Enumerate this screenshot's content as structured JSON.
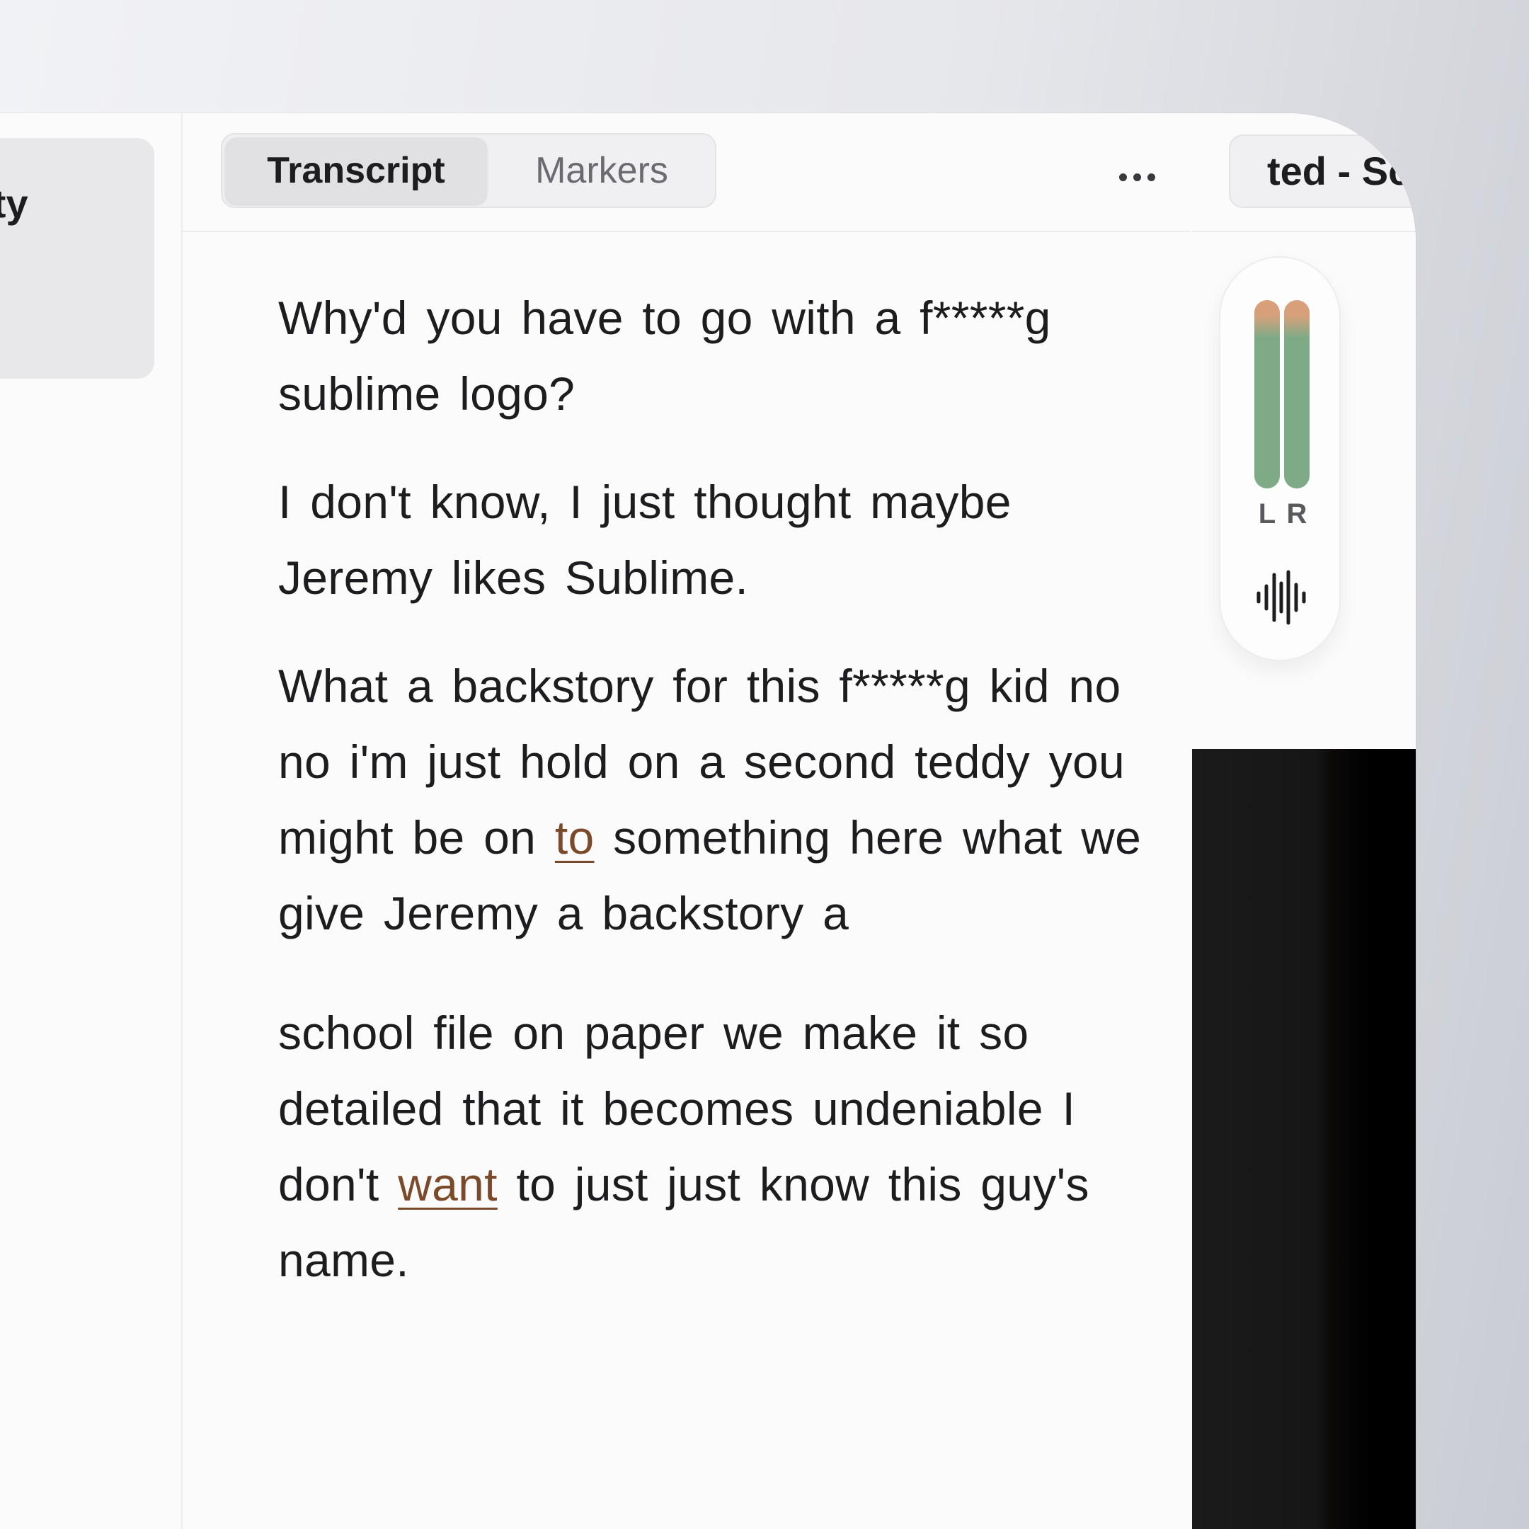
{
  "left_pane": {
    "card_title_fragment": "rty"
  },
  "center": {
    "tabs": [
      {
        "label": "Transcript",
        "active": true
      },
      {
        "label": "Markers",
        "active": false
      }
    ],
    "more_icon": "ellipsis-icon",
    "transcript": {
      "paragraphs": [
        {
          "text": "Why'd you have to go with a f*****g sublime logo?"
        },
        {
          "text": "I don't know, I just thought maybe Jeremy likes Sublime."
        },
        {
          "before": "What a backstory for this f*****g kid no no i'm just hold on a second teddy you might be on ",
          "highlight": "to",
          "after": " something here what we give Jeremy a backstory a"
        },
        {
          "before": "school file on paper we make it so detailed that it becomes undeniable I don't ",
          "highlight": "want",
          "after": " to just just know this guy's name."
        }
      ],
      "highlight_color": "#7a4a2a"
    }
  },
  "right": {
    "tab_label": "ted - Sc",
    "meter": {
      "left_label": "L",
      "right_label": "R",
      "left_level": 1.0,
      "right_level": 1.0,
      "colors": {
        "normal": "#7eab86",
        "peak": "#d8a07a",
        "track": "#cfcfd2"
      }
    },
    "waveform_icon": "audio-waveform-icon"
  }
}
